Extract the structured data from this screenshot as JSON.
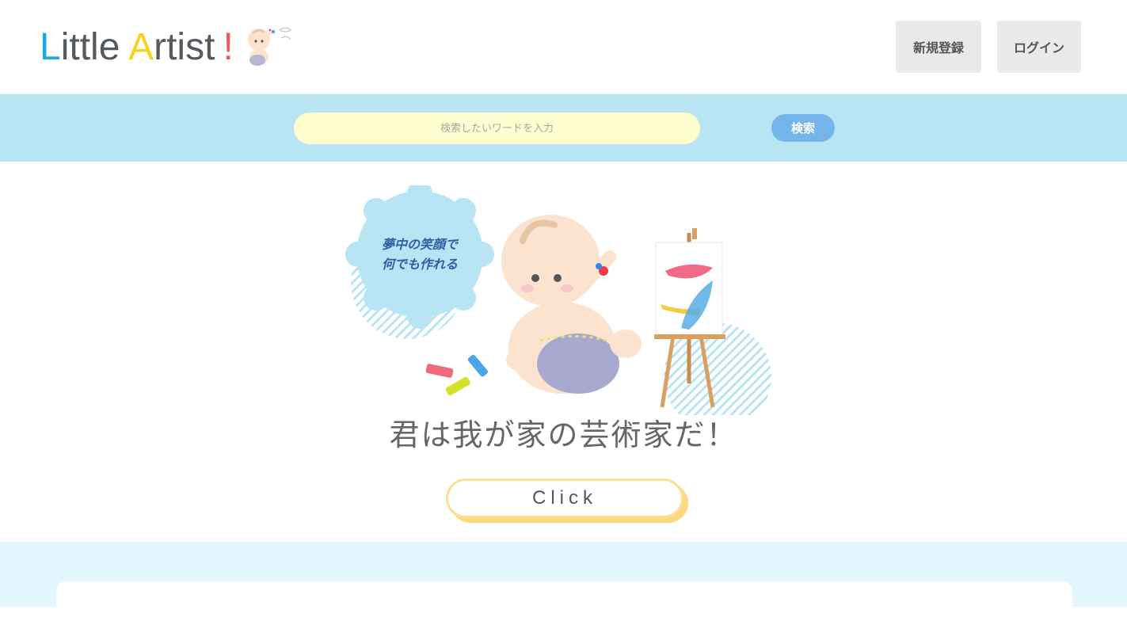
{
  "header": {
    "logo": {
      "letter_l": "L",
      "rest_l": "ittle ",
      "letter_a": "A",
      "rest_a": "rtist",
      "exclaim": "!"
    },
    "signup_label": "新規登録",
    "login_label": "ログイン"
  },
  "search": {
    "placeholder": "検索したいワードを入力",
    "button_label": "検索"
  },
  "hero": {
    "bubble_line1": "夢中の笑顔で",
    "bubble_line2": "何でも作れる",
    "catchphrase": "君は我が家の芸術家だ！",
    "cta_label": "Click"
  },
  "colors": {
    "search_band": "#b8e4f4",
    "search_input": "#fefed0",
    "search_button": "#74b5ec",
    "cta_border": "#fbe08f",
    "bottom_bg": "#e2f7fd"
  }
}
